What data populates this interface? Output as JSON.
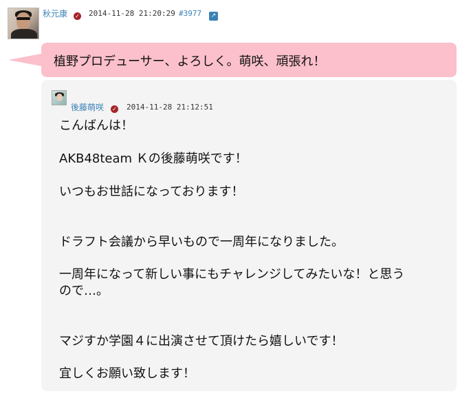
{
  "post": {
    "author": "秋元康",
    "timestamp": "2014-11-28 21:20:29",
    "post_id": "#3977",
    "bubble_text": "植野プロデューサー、よろしく。萌咲、頑張れ！"
  },
  "reply": {
    "author": "後藤萌咲",
    "timestamp": "2014-11-28 21:12:51",
    "lines": [
      "こんばんは！",
      "AKB48team Ｋの後藤萌咲です！",
      "いつもお世話になっております！",
      "ドラフト会議から早いもので一周年になりました。",
      "一周年になって新しい事にもチャレンジしてみたいな！と思う",
      "ので…。",
      "マジすか学園４に出演させて頂けたら嬉しいです！",
      "宜しくお願い致します！"
    ]
  },
  "icons": {
    "verified": "verified-check-icon",
    "link": "external-link-icon"
  },
  "colors": {
    "bubble": "#fbc0cb",
    "card": "#f4f4f4",
    "link": "#3a82b6",
    "verified": "#a4242a"
  }
}
